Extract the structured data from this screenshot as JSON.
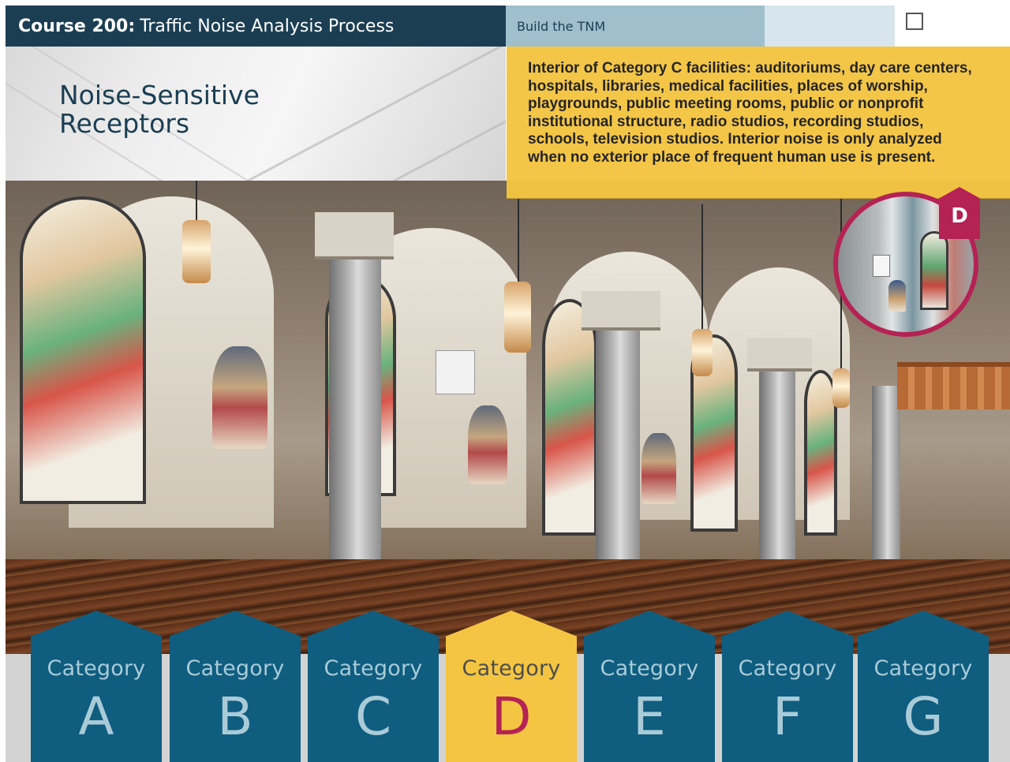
{
  "header": {
    "course_label": "Course 200:",
    "course_title": "Traffic Noise Analysis Process"
  },
  "tab": {
    "label": "Build the TNM"
  },
  "page": {
    "title_line1": "Noise-Sensitive",
    "title_line2": "Receptors"
  },
  "info_box": {
    "text": "Interior of Category C facilities: auditoriums, day care centers, hospitals, libraries, medical facilities, places of worship, playgrounds, public meeting rooms, public or nonprofit institutional structure, radio studios, recording studios, schools, television studios. Interior noise is only analyzed when no exterior place of frequent human use is present."
  },
  "magnifier": {
    "badge": "D"
  },
  "categories": [
    {
      "label": "Category",
      "letter": "A"
    },
    {
      "label": "Category",
      "letter": "B"
    },
    {
      "label": "Category",
      "letter": "C"
    },
    {
      "label": "Category",
      "letter": "D"
    },
    {
      "label": "Category",
      "letter": "E"
    },
    {
      "label": "Category",
      "letter": "F"
    },
    {
      "label": "Category",
      "letter": "G"
    }
  ],
  "selected_category": "D",
  "colors": {
    "header_bg": "#1b3e53",
    "tab_bg": "#9fbfcc",
    "info_bg": "#f4c542",
    "category_bg": "#0f5d7f",
    "category_active_bg": "#f4c542",
    "accent": "#b52254"
  }
}
